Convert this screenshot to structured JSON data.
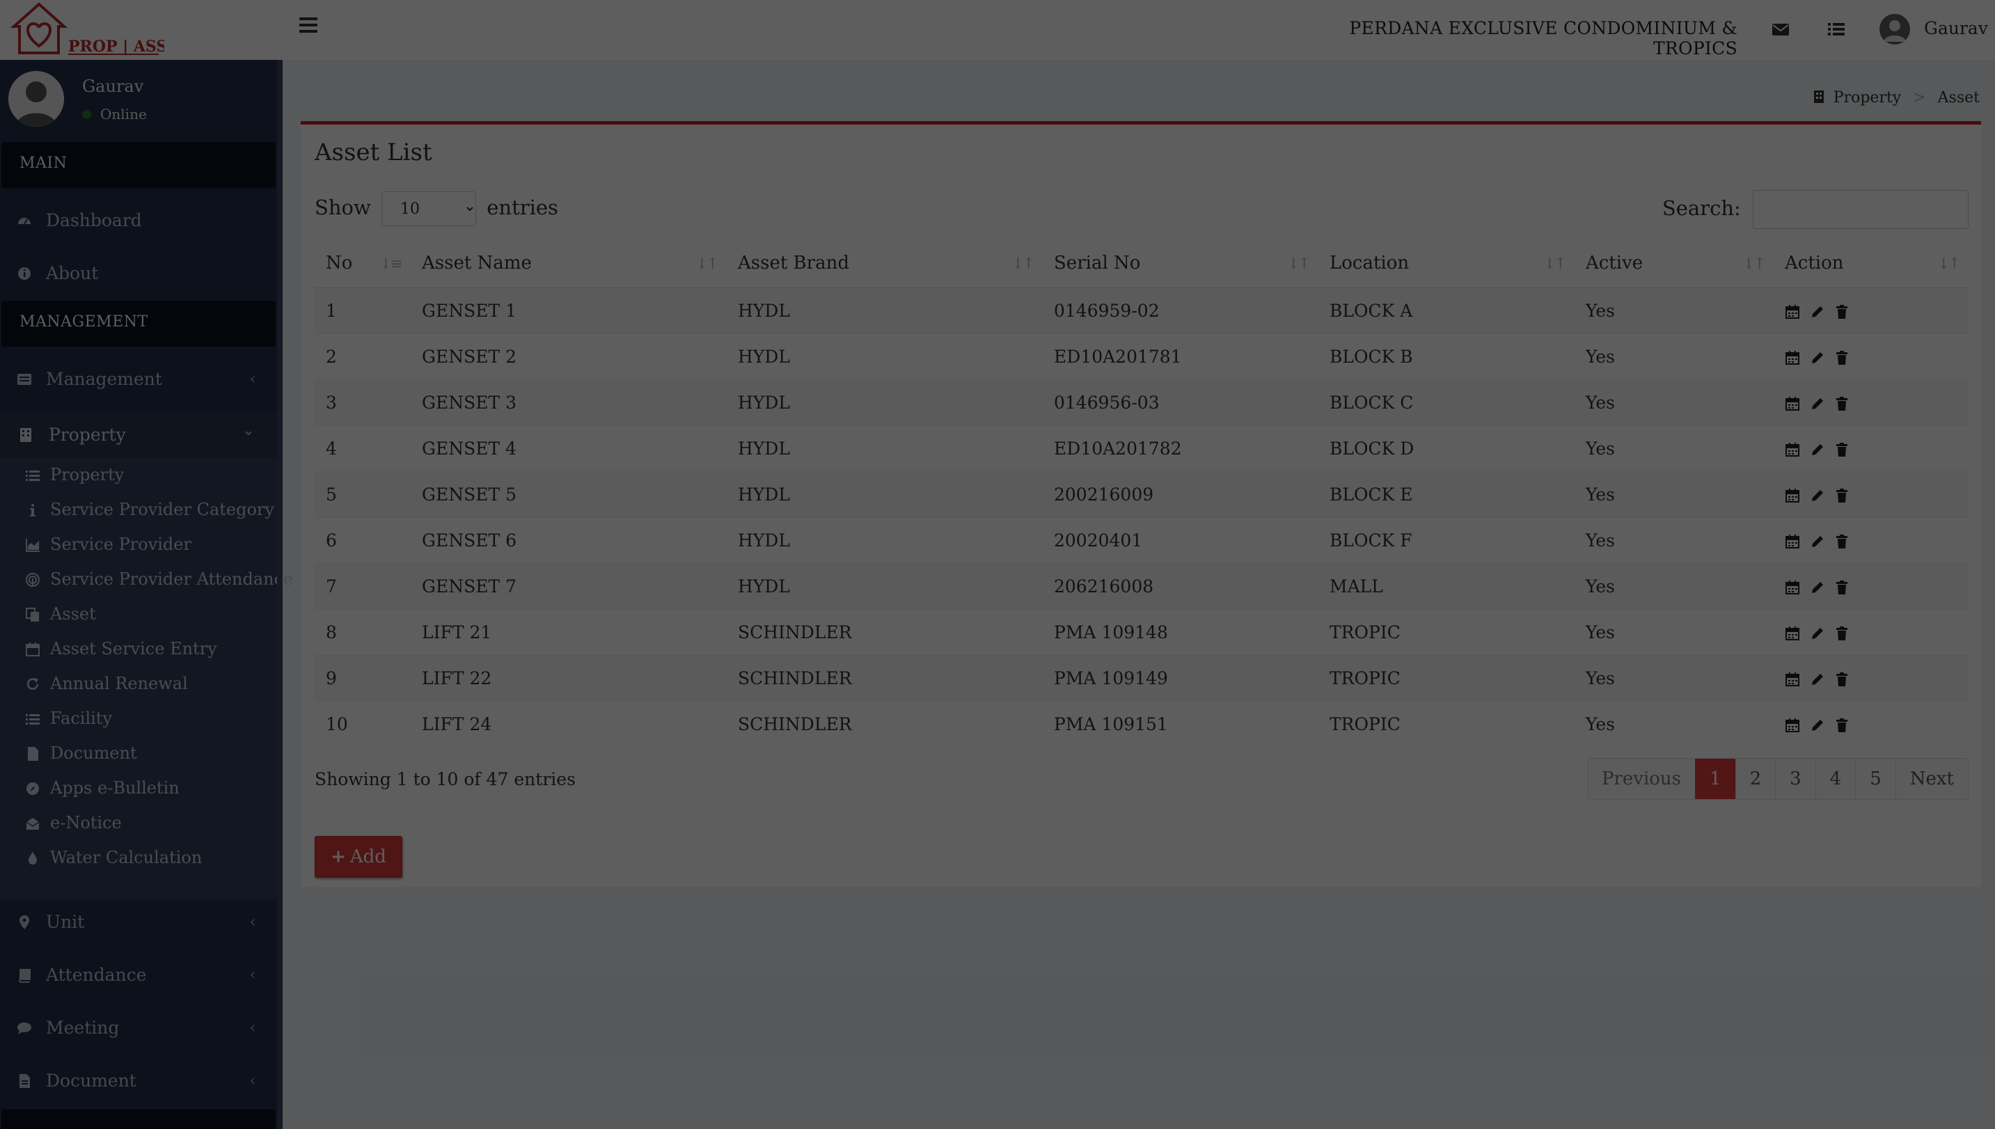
{
  "app": {
    "logo_text": "PROP | ASSIST",
    "property_name": "PERDANA EXCLUSIVE CONDOMINIUM & TROPICS",
    "user_name": "Gaurav",
    "colors": {
      "accent": "#c91f1f",
      "sidebar": "#253049",
      "header": "#ffffff"
    }
  },
  "sidebar": {
    "user": {
      "name": "Gaurav",
      "status": "Online"
    },
    "section_main": "MAIN",
    "main_items": [
      {
        "label": "Dashboard",
        "icon": "dashboard-icon"
      },
      {
        "label": "About",
        "icon": "info-icon"
      }
    ],
    "section_management": "MANAGEMENT",
    "management": {
      "label": "Management",
      "icon": "list-alt-icon"
    },
    "property": {
      "label": "Property",
      "icon": "building-icon",
      "children": [
        {
          "label": "Property",
          "icon": "list-icon"
        },
        {
          "label": "Service Provider Category",
          "icon": "info-icon"
        },
        {
          "label": "Service Provider",
          "icon": "chart-icon"
        },
        {
          "label": "Service Provider Attendance",
          "icon": "fingerprint-icon"
        },
        {
          "label": "Asset",
          "icon": "copy-icon"
        },
        {
          "label": "Asset Service Entry",
          "icon": "calendar-icon"
        },
        {
          "label": "Annual Renewal",
          "icon": "refresh-icon"
        },
        {
          "label": "Facility",
          "icon": "list-icon"
        },
        {
          "label": "Document",
          "icon": "file-icon"
        },
        {
          "label": "Apps e-Bulletin",
          "icon": "compass-icon"
        },
        {
          "label": "e-Notice",
          "icon": "envelope-open-icon"
        },
        {
          "label": "Water Calculation",
          "icon": "droplet-icon"
        }
      ]
    },
    "bottom_items": [
      {
        "label": "Unit",
        "icon": "map-marker-icon"
      },
      {
        "label": "Attendance",
        "icon": "book-icon"
      },
      {
        "label": "Meeting",
        "icon": "comment-icon"
      },
      {
        "label": "Document",
        "icon": "file-icon"
      }
    ]
  },
  "breadcrumb": {
    "parent": "Property",
    "current": "Asset",
    "separator": ">"
  },
  "asset_list": {
    "title": "Asset List",
    "show_label": "Show",
    "entries_label": "entries",
    "page_length": "10",
    "search_label": "Search:",
    "search_value": "",
    "columns": [
      "No",
      "Asset Name",
      "Asset Brand",
      "Serial No",
      "Location",
      "Active",
      "Action"
    ],
    "rows": [
      {
        "no": "1",
        "name": "GENSET 1",
        "brand": "HYDL",
        "serial": "0146959-02",
        "location": "BLOCK A",
        "active": "Yes"
      },
      {
        "no": "2",
        "name": "GENSET 2",
        "brand": "HYDL",
        "serial": "ED10A201781",
        "location": "BLOCK B",
        "active": "Yes"
      },
      {
        "no": "3",
        "name": "GENSET 3",
        "brand": "HYDL",
        "serial": "0146956-03",
        "location": "BLOCK C",
        "active": "Yes"
      },
      {
        "no": "4",
        "name": "GENSET 4",
        "brand": "HYDL",
        "serial": "ED10A201782",
        "location": "BLOCK D",
        "active": "Yes"
      },
      {
        "no": "5",
        "name": "GENSET 5",
        "brand": "HYDL",
        "serial": "200216009",
        "location": "BLOCK E",
        "active": "Yes"
      },
      {
        "no": "6",
        "name": "GENSET 6",
        "brand": "HYDL",
        "serial": "20020401",
        "location": "BLOCK F",
        "active": "Yes"
      },
      {
        "no": "7",
        "name": "GENSET 7",
        "brand": "HYDL",
        "serial": "206216008",
        "location": "MALL",
        "active": "Yes"
      },
      {
        "no": "8",
        "name": "LIFT 21",
        "brand": "SCHINDLER",
        "serial": "PMA 109148",
        "location": "TROPIC",
        "active": "Yes"
      },
      {
        "no": "9",
        "name": "LIFT 22",
        "brand": "SCHINDLER",
        "serial": "PMA 109149",
        "location": "TROPIC",
        "active": "Yes"
      },
      {
        "no": "10",
        "name": "LIFT 24",
        "brand": "SCHINDLER",
        "serial": "PMA 109151",
        "location": "TROPIC",
        "active": "Yes"
      }
    ],
    "row_actions": [
      "calendar-icon",
      "pencil-icon",
      "trash-icon"
    ],
    "info": "Showing 1 to 10 of 47 entries",
    "pagination": [
      "Previous",
      "1",
      "2",
      "3",
      "4",
      "5",
      "Next"
    ],
    "current_page": "1",
    "add_label": "Add"
  }
}
